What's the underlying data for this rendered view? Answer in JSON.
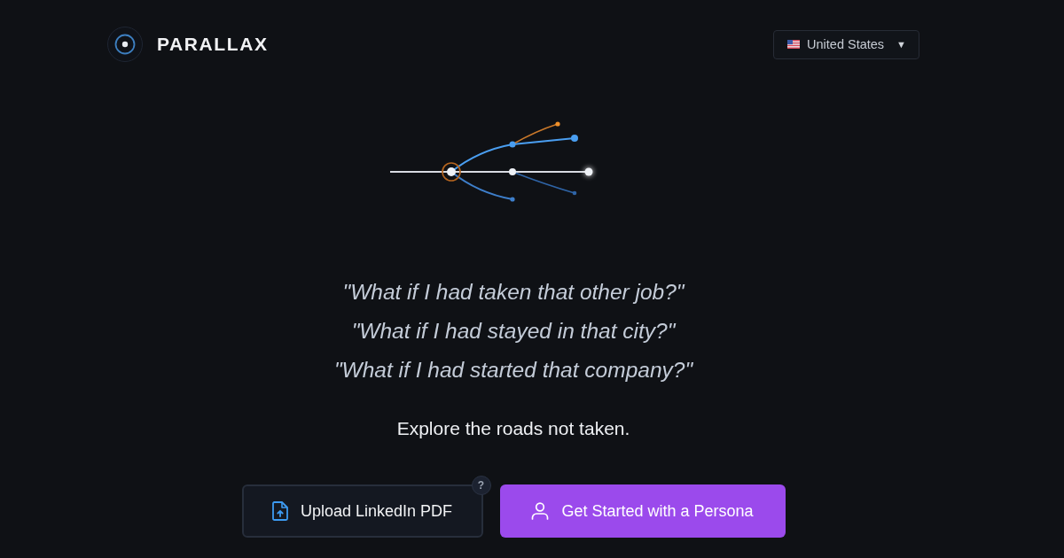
{
  "header": {
    "logo_text": "PARALLAX",
    "country_selector": {
      "label": "United States",
      "caret": "▼"
    }
  },
  "quotes": [
    "\"What if I had taken that other job?\"",
    "\"What if I had stayed in that city?\"",
    "\"What if I had started that company?\""
  ],
  "tagline": "Explore the roads not taken.",
  "actions": [
    {
      "kind": "upload",
      "label": "Upload LinkedIn PDF",
      "help_badge": "?"
    },
    {
      "kind": "persona",
      "label": "Get Started with a Persona"
    }
  ]
}
